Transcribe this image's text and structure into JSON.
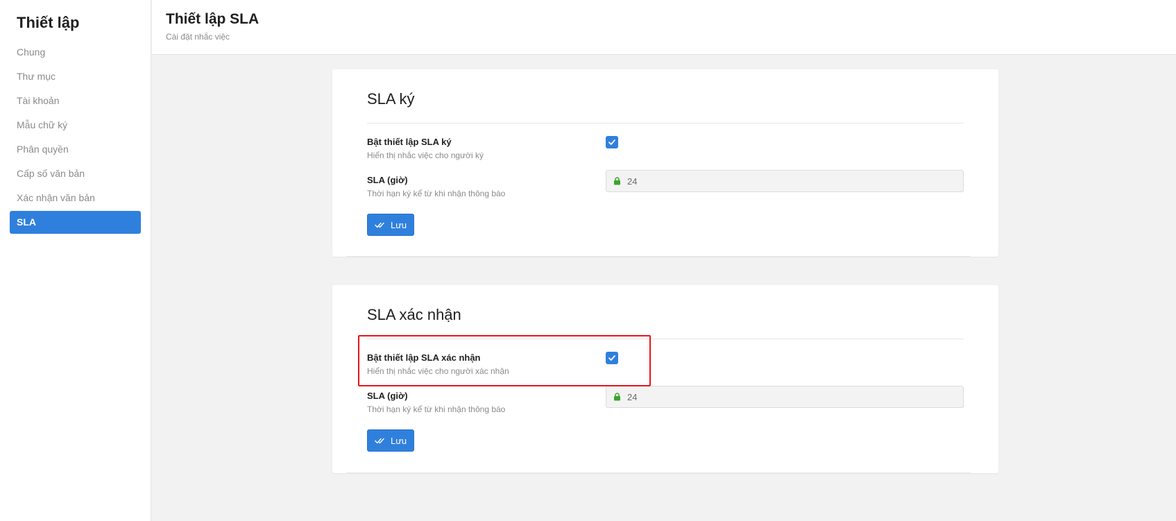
{
  "sidebar": {
    "title": "Thiết lập",
    "items": [
      {
        "label": "Chung"
      },
      {
        "label": "Thư mục"
      },
      {
        "label": "Tài khoản"
      },
      {
        "label": "Mẫu chữ ký"
      },
      {
        "label": "Phân quyền"
      },
      {
        "label": "Cấp số văn bản"
      },
      {
        "label": "Xác nhận văn bản"
      },
      {
        "label": "SLA"
      }
    ],
    "active_item": "SLA"
  },
  "header": {
    "title": "Thiết lập SLA",
    "subtitle": "Cài đặt nhắc việc"
  },
  "sections": [
    {
      "title": "SLA ký",
      "toggle": {
        "label": "Bật thiết lập SLA ký",
        "hint": "Hiển thị nhắc việc cho người ký",
        "checked": true
      },
      "sla": {
        "label": "SLA (giờ)",
        "hint": "Thời hạn ký kể từ khi nhận thông báo",
        "value": "24",
        "locked": true
      },
      "save_label": "Lưu"
    },
    {
      "title": "SLA xác nhận",
      "toggle": {
        "label": "Bật thiết lập SLA xác nhận",
        "hint": "Hiển thị nhắc việc cho người xác nhận",
        "checked": true
      },
      "sla": {
        "label": "SLA (giờ)",
        "hint": "Thời hạn ký kể từ khi nhận thông báo",
        "value": "24",
        "locked": true
      },
      "save_label": "Lưu"
    }
  ],
  "colors": {
    "accent": "#2f80dd",
    "highlight": "#e8141b",
    "lock": "#3aa52a",
    "background": "#f2f2f2"
  },
  "icons": {
    "checkbox": "check-icon",
    "field_lock": "lock-icon",
    "save": "double-check-icon"
  }
}
